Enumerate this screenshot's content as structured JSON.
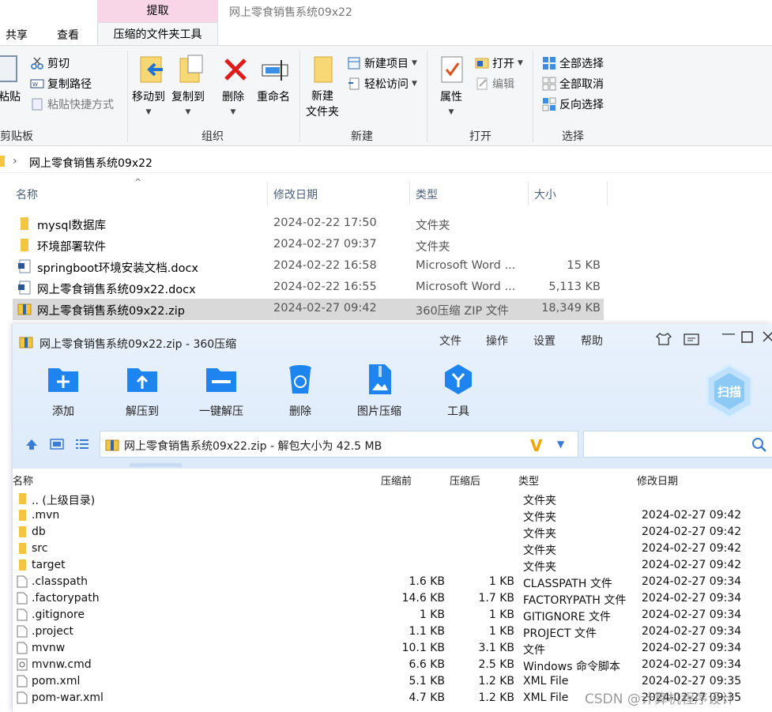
{
  "ribbon": {
    "context_group": "提取",
    "window_title": "网上零食销售系统09x22",
    "tabs": {
      "share": "共享",
      "view": "查看",
      "active": "压缩的文件夹工具"
    },
    "clipboard": {
      "paste": "粘贴",
      "cut": "剪切",
      "copy_path": "复制路径",
      "paste_shortcut": "粘贴快捷方式",
      "group": "剪贴板"
    },
    "organize": {
      "move_to": "移动到",
      "copy_to": "复制到",
      "delete": "删除",
      "rename": "重命名",
      "group": "组织"
    },
    "new": {
      "new_folder_1": "新建",
      "new_folder_2": "文件夹",
      "new_item": "新建项目",
      "easy_access": "轻松访问",
      "group": "新建"
    },
    "open": {
      "properties": "属性",
      "open": "打开",
      "edit": "编辑",
      "group": "打开"
    },
    "select": {
      "select_all": "全部选择",
      "select_none": "全部取消",
      "invert": "反向选择",
      "group": "选择"
    }
  },
  "address": {
    "path": "网上零食销售系统09x22"
  },
  "file_list": {
    "headers": {
      "name": "名称",
      "modified": "修改日期",
      "type": "类型",
      "size": "大小"
    },
    "rows": [
      {
        "name": "mysql数据库",
        "modified": "2024-02-22 17:50",
        "type": "文件夹",
        "size": "",
        "icon": "folder-icon"
      },
      {
        "name": "环境部署软件",
        "modified": "2024-02-27 09:37",
        "type": "文件夹",
        "size": "",
        "icon": "folder-icon"
      },
      {
        "name": "springboot环境安装文档.docx",
        "modified": "2024-02-22 16:58",
        "type": "Microsoft Word ...",
        "size": "15 KB",
        "icon": "word-icon"
      },
      {
        "name": "网上零食销售系统09x22.docx",
        "modified": "2024-02-22 16:55",
        "type": "Microsoft Word ...",
        "size": "5,113 KB",
        "icon": "word-icon"
      },
      {
        "name": "网上零食销售系统09x22.zip",
        "modified": "2024-02-27 09:42",
        "type": "360压缩 ZIP 文件",
        "size": "18,349 KB",
        "icon": "zip-icon"
      }
    ]
  },
  "zip_window": {
    "title": "网上零食销售系统09x22.zip - 360压缩",
    "menu": {
      "file": "文件",
      "operation": "操作",
      "settings": "设置",
      "help": "帮助"
    },
    "tools": {
      "add": "添加",
      "extract_to": "解压到",
      "one_click": "一键解压",
      "delete": "删除",
      "image_compress": "图片压缩",
      "tools": "工具"
    },
    "scan": "扫描",
    "address_text": "网上零食销售系统09x22.zip - 解包大小为 42.5 MB",
    "headers": {
      "name": "名称",
      "packed": "压缩前",
      "compressed": "压缩后",
      "type": "类型",
      "modified": "修改日期"
    },
    "rows": [
      {
        "name": ".. (上级目录)",
        "packed": "",
        "compressed": "",
        "type": "文件夹",
        "modified": "",
        "icon": "folder-icon"
      },
      {
        "name": ".mvn",
        "packed": "",
        "compressed": "",
        "type": "文件夹",
        "modified": "2024-02-27 09:42",
        "icon": "folder-icon"
      },
      {
        "name": "db",
        "packed": "",
        "compressed": "",
        "type": "文件夹",
        "modified": "2024-02-27 09:42",
        "icon": "folder-icon"
      },
      {
        "name": "src",
        "packed": "",
        "compressed": "",
        "type": "文件夹",
        "modified": "2024-02-27 09:42",
        "icon": "folder-icon"
      },
      {
        "name": "target",
        "packed": "",
        "compressed": "",
        "type": "文件夹",
        "modified": "2024-02-27 09:42",
        "icon": "folder-icon"
      },
      {
        "name": ".classpath",
        "packed": "1.6 KB",
        "compressed": "1 KB",
        "type": "CLASSPATH 文件",
        "modified": "2024-02-27 09:34",
        "icon": "file-icon"
      },
      {
        "name": ".factorypath",
        "packed": "14.6 KB",
        "compressed": "1.7 KB",
        "type": "FACTORYPATH 文件",
        "modified": "2024-02-27 09:34",
        "icon": "file-icon"
      },
      {
        "name": ".gitignore",
        "packed": "1 KB",
        "compressed": "1 KB",
        "type": "GITIGNORE 文件",
        "modified": "2024-02-27 09:34",
        "icon": "file-icon"
      },
      {
        "name": ".project",
        "packed": "1.1 KB",
        "compressed": "1 KB",
        "type": "PROJECT 文件",
        "modified": "2024-02-27 09:34",
        "icon": "file-icon"
      },
      {
        "name": "mvnw",
        "packed": "10.1 KB",
        "compressed": "3.1 KB",
        "type": "文件",
        "modified": "2024-02-27 09:34",
        "icon": "file-icon"
      },
      {
        "name": "mvnw.cmd",
        "packed": "6.6 KB",
        "compressed": "2.5 KB",
        "type": "Windows 命令脚本",
        "modified": "2024-02-27 09:34",
        "icon": "cmd-icon"
      },
      {
        "name": "pom.xml",
        "packed": "5.1 KB",
        "compressed": "1.2 KB",
        "type": "XML File",
        "modified": "2024-02-27 09:35",
        "icon": "file-icon"
      },
      {
        "name": "pom-war.xml",
        "packed": "4.7 KB",
        "compressed": "1.2 KB",
        "type": "XML File",
        "modified": "2024-02-27 09:35",
        "icon": "file-icon"
      }
    ]
  },
  "watermark": "CSDN @计算机程序设计"
}
